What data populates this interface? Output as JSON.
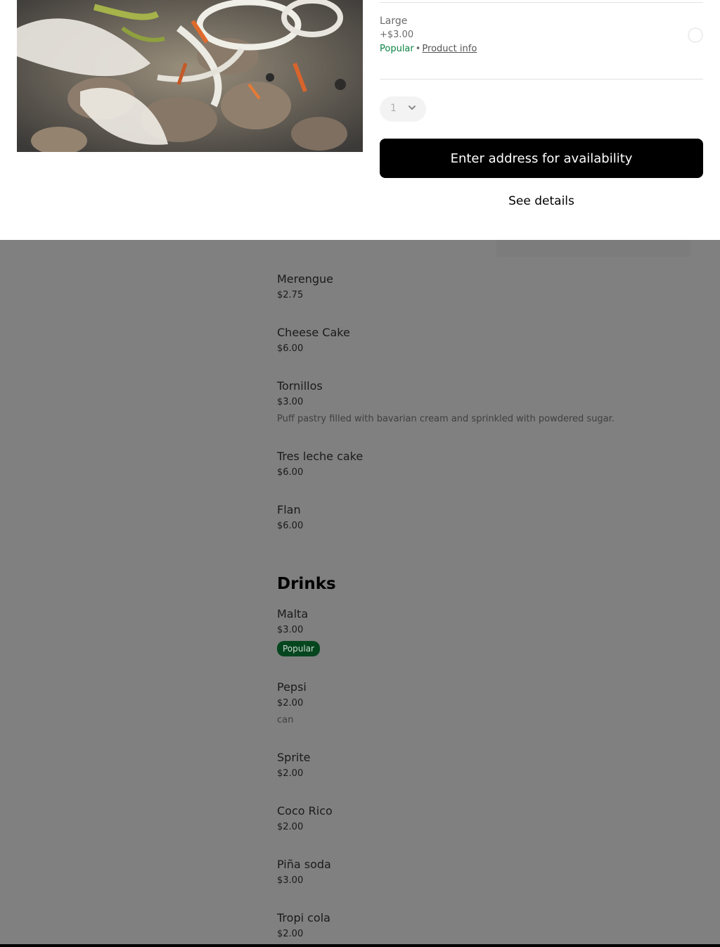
{
  "option": {
    "name": "Large",
    "price": "+$3.00",
    "popular": "Popular",
    "separator": "•",
    "info_link": "Product info"
  },
  "quantity": {
    "value": "1"
  },
  "actions": {
    "cta_label": "Enter address for availability",
    "details_label": "See details"
  },
  "menu": {
    "desserts": [
      {
        "name": "Merengue",
        "price": "$2.75"
      },
      {
        "name": "Cheese Cake",
        "price": "$6.00"
      },
      {
        "name": "Tornillos",
        "price": "$3.00",
        "description": "Puff pastry filled with bavarian cream and sprinkled with powdered sugar."
      },
      {
        "name": "Tres leche cake",
        "price": "$6.00"
      },
      {
        "name": "Flan",
        "price": "$6.00"
      }
    ],
    "drinks_title": "Drinks",
    "drinks": [
      {
        "name": "Malta",
        "price": "$3.00",
        "badge": "Popular"
      },
      {
        "name": "Pepsi",
        "price": "$2.00",
        "description": "can"
      },
      {
        "name": "Sprite",
        "price": "$2.00"
      },
      {
        "name": "Coco Rico",
        "price": "$2.00"
      },
      {
        "name": "Piña soda",
        "price": "$3.00"
      },
      {
        "name": "Tropi cola",
        "price": "$2.00"
      }
    ]
  },
  "colors": {
    "popular_text": "#0e8345",
    "badge_bg": "#06461f",
    "cta_bg": "#000000",
    "backdrop": "#808080"
  }
}
